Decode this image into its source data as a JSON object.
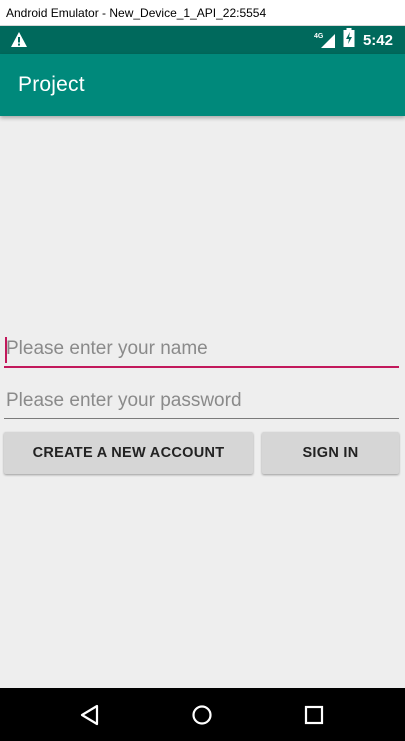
{
  "window": {
    "title": "Android Emulator - New_Device_1_API_22:5554"
  },
  "status_bar": {
    "warning_icon": "warning-icon",
    "network_label": "4G",
    "signal_icon": "signal-icon",
    "battery_icon": "battery-charging-icon",
    "time": "5:42",
    "color": "#00695c"
  },
  "app_bar": {
    "title": "Project",
    "color": "#00897b"
  },
  "form": {
    "name_placeholder": "Please enter your name",
    "name_value": "",
    "password_placeholder": "Please enter your password",
    "password_value": "",
    "accent_color": "#c2185b"
  },
  "buttons": {
    "create_account": "CREATE A NEW ACCOUNT",
    "sign_in": "SIGN IN"
  },
  "nav_bar": {
    "back_icon": "back-icon",
    "home_icon": "home-icon",
    "recents_icon": "recents-icon"
  }
}
